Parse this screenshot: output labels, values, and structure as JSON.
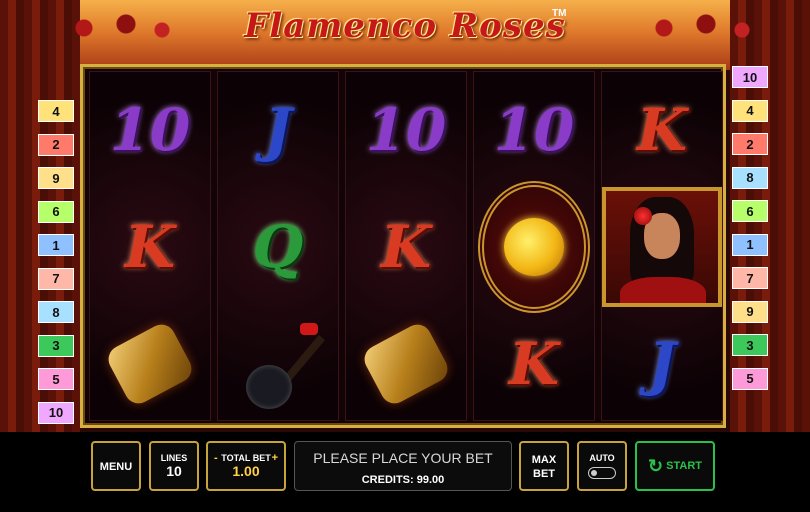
{
  "game": {
    "title": "Flamenco Roses",
    "trademark": "TM"
  },
  "reels": [
    [
      "10",
      "K",
      "bracelet"
    ],
    [
      "J",
      "Q",
      "guitar"
    ],
    [
      "10",
      "K",
      "bracelet"
    ],
    [
      "10",
      "rose",
      "K"
    ],
    [
      "K",
      "flamenco-lady",
      "J"
    ]
  ],
  "paylines_left": [
    "4",
    "2",
    "9",
    "6",
    "1",
    "7",
    "8",
    "3",
    "5",
    "10"
  ],
  "paylines_right": [
    "10",
    "4",
    "2",
    "8",
    "6",
    "1",
    "7",
    "9",
    "3",
    "5"
  ],
  "payline_colors": {
    "1": "#8fc0ff",
    "2": "#ff7a6a",
    "3": "#3cc85a",
    "4": "#ffe37a",
    "5": "#ff9ad8",
    "6": "#b6ff6a",
    "7": "#ffb8a8",
    "8": "#a8e0ff",
    "9": "#ffe08a",
    "10": "#f0a8ff"
  },
  "controls": {
    "menu": "MENU",
    "lines_label": "LINES",
    "lines_value": "10",
    "total_bet_label": "TOTAL BET",
    "total_bet_minus": "-",
    "total_bet_plus": "+",
    "total_bet_value": "1.00",
    "message": "PLEASE PLACE YOUR BET",
    "credits": "CREDITS: 99.00",
    "max_bet_1": "MAX",
    "max_bet_2": "BET",
    "auto": "AUTO",
    "start": "START"
  },
  "colors": {
    "accent_gold": "#c8a23a",
    "start_green": "#2bc04a"
  }
}
